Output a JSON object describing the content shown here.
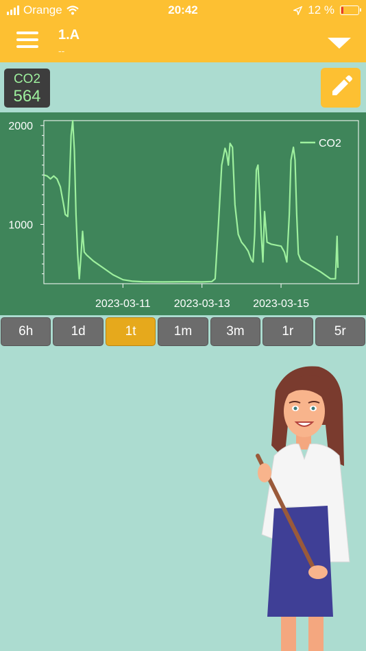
{
  "status_bar": {
    "carrier": "Orange",
    "time": "20:42",
    "battery_percent": "12 %",
    "battery_level": 0.12
  },
  "header": {
    "title": "1.A",
    "subtitle": "--"
  },
  "co2": {
    "label": "CO2",
    "value": "564"
  },
  "icons": {
    "menu": "hamburger-icon",
    "dropdown": "chevron-down-icon",
    "edit": "pencil-icon",
    "wifi": "wifi-icon",
    "location": "location-arrow-icon",
    "battery": "battery-icon"
  },
  "range_buttons": [
    {
      "label": "6h",
      "active": false
    },
    {
      "label": "1d",
      "active": false
    },
    {
      "label": "1t",
      "active": true
    },
    {
      "label": "1m",
      "active": false
    },
    {
      "label": "3m",
      "active": false
    },
    {
      "label": "1r",
      "active": false
    },
    {
      "label": "5r",
      "active": false
    }
  ],
  "colors": {
    "header_bg": "#fdc032",
    "page_bg": "#acdcd0",
    "chart_bg": "#3f855a",
    "series_line": "#9ef09e",
    "active_button": "#e6a91c"
  },
  "chart_data": {
    "type": "line",
    "title": "",
    "xlabel": "",
    "ylabel": "",
    "xlim": [
      "2023-03-09 00:00",
      "2023-03-16 23:00"
    ],
    "ylim": [
      400,
      2050
    ],
    "x_tick_labels": [
      "2023-03-11",
      "2023-03-13",
      "2023-03-15"
    ],
    "y_tick_labels": [
      "1000",
      "2000"
    ],
    "legend": {
      "position": "top-right"
    },
    "grid": false,
    "series": [
      {
        "name": "CO2",
        "points": [
          [
            "2023-03-09 00:00",
            1500
          ],
          [
            "2023-03-09 02:00",
            1490
          ],
          [
            "2023-03-09 04:00",
            1460
          ],
          [
            "2023-03-09 06:00",
            1490
          ],
          [
            "2023-03-09 08:00",
            1460
          ],
          [
            "2023-03-09 10:00",
            1380
          ],
          [
            "2023-03-09 12:00",
            1200
          ],
          [
            "2023-03-09 13:00",
            1100
          ],
          [
            "2023-03-09 14:30",
            1080
          ],
          [
            "2023-03-09 15:30",
            1400
          ],
          [
            "2023-03-09 16:30",
            1900
          ],
          [
            "2023-03-09 17:30",
            2050
          ],
          [
            "2023-03-09 18:30",
            1750
          ],
          [
            "2023-03-09 19:30",
            1100
          ],
          [
            "2023-03-09 20:30",
            700
          ],
          [
            "2023-03-09 21:30",
            450
          ],
          [
            "2023-03-09 22:30",
            680
          ],
          [
            "2023-03-09 23:30",
            930
          ],
          [
            "2023-03-10 00:30",
            720
          ],
          [
            "2023-03-10 02:00",
            690
          ],
          [
            "2023-03-10 06:00",
            630
          ],
          [
            "2023-03-10 12:00",
            560
          ],
          [
            "2023-03-10 18:00",
            490
          ],
          [
            "2023-03-11 00:00",
            440
          ],
          [
            "2023-03-11 06:00",
            425
          ],
          [
            "2023-03-11 12:00",
            420
          ],
          [
            "2023-03-12 00:00",
            418
          ],
          [
            "2023-03-12 12:00",
            420
          ],
          [
            "2023-03-13 00:00",
            418
          ],
          [
            "2023-03-13 06:00",
            422
          ],
          [
            "2023-03-13 08:00",
            450
          ],
          [
            "2023-03-13 10:00",
            1000
          ],
          [
            "2023-03-13 12:00",
            1600
          ],
          [
            "2023-03-13 14:00",
            1770
          ],
          [
            "2023-03-13 15:00",
            1720
          ],
          [
            "2023-03-13 16:00",
            1600
          ],
          [
            "2023-03-13 17:00",
            1820
          ],
          [
            "2023-03-13 18:30",
            1780
          ],
          [
            "2023-03-13 20:00",
            1200
          ],
          [
            "2023-03-13 22:00",
            900
          ],
          [
            "2023-03-14 00:00",
            820
          ],
          [
            "2023-03-14 02:00",
            780
          ],
          [
            "2023-03-14 04:00",
            730
          ],
          [
            "2023-03-14 06:00",
            640
          ],
          [
            "2023-03-14 07:00",
            620
          ],
          [
            "2023-03-14 08:00",
            900
          ],
          [
            "2023-03-14 09:00",
            1550
          ],
          [
            "2023-03-14 10:00",
            1600
          ],
          [
            "2023-03-14 11:00",
            1300
          ],
          [
            "2023-03-14 12:00",
            900
          ],
          [
            "2023-03-14 13:00",
            620
          ],
          [
            "2023-03-14 14:00",
            1130
          ],
          [
            "2023-03-14 15:30",
            820
          ],
          [
            "2023-03-14 18:00",
            800
          ],
          [
            "2023-03-15 00:00",
            780
          ],
          [
            "2023-03-15 02:00",
            720
          ],
          [
            "2023-03-15 03:30",
            620
          ],
          [
            "2023-03-15 05:00",
            1100
          ],
          [
            "2023-03-15 06:00",
            1650
          ],
          [
            "2023-03-15 07:30",
            1780
          ],
          [
            "2023-03-15 08:30",
            1650
          ],
          [
            "2023-03-15 09:30",
            1100
          ],
          [
            "2023-03-15 10:30",
            700
          ],
          [
            "2023-03-15 12:00",
            640
          ],
          [
            "2023-03-15 18:00",
            580
          ],
          [
            "2023-03-16 00:00",
            520
          ],
          [
            "2023-03-16 06:00",
            450
          ],
          [
            "2023-03-16 09:00",
            450
          ],
          [
            "2023-03-16 10:00",
            880
          ],
          [
            "2023-03-16 10:30",
            560
          ]
        ]
      }
    ]
  }
}
